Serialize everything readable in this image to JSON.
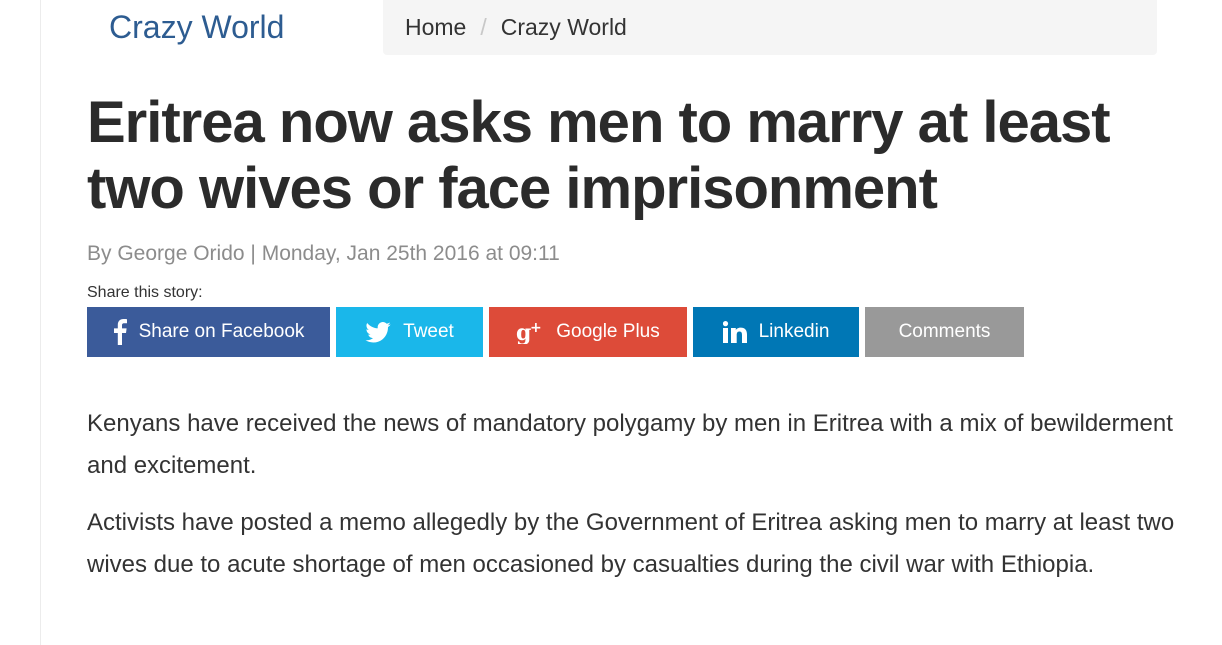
{
  "header": {
    "section_title": "Crazy World",
    "breadcrumb": {
      "items": [
        "Home",
        "Crazy World"
      ],
      "separator": "/"
    }
  },
  "article": {
    "headline": "Eritrea now asks men to marry at least two wives or face imprisonment",
    "byline": "By George Orido | Monday, Jan 25th 2016 at 09:11",
    "share_label": "Share this story:",
    "share_buttons": [
      {
        "label": "Share on Facebook",
        "icon": "facebook-icon",
        "color": "#3b5b9a"
      },
      {
        "label": "Tweet",
        "icon": "twitter-icon",
        "color": "#1ab7ea"
      },
      {
        "label": "Google Plus",
        "icon": "google-plus-icon",
        "color": "#dd4b39"
      },
      {
        "label": "Linkedin",
        "icon": "linkedin-icon",
        "color": "#0077b5"
      },
      {
        "label": "Comments",
        "icon": "",
        "color": "#999999"
      }
    ],
    "paragraphs": [
      "Kenyans have received the news of mandatory polygamy by men in Eritrea with a mix of bewilderment and excitement.",
      "Activists have posted a memo allegedly by the Government of Eritrea asking men to marry at least two wives due to acute shortage of men occasioned by casualties during the civil war with Ethiopia."
    ]
  },
  "colors": {
    "section_title": "#2d5c91",
    "headline": "#2b2b2b",
    "byline": "#8c8c8c",
    "breadcrumb_bg": "#f5f5f5"
  }
}
